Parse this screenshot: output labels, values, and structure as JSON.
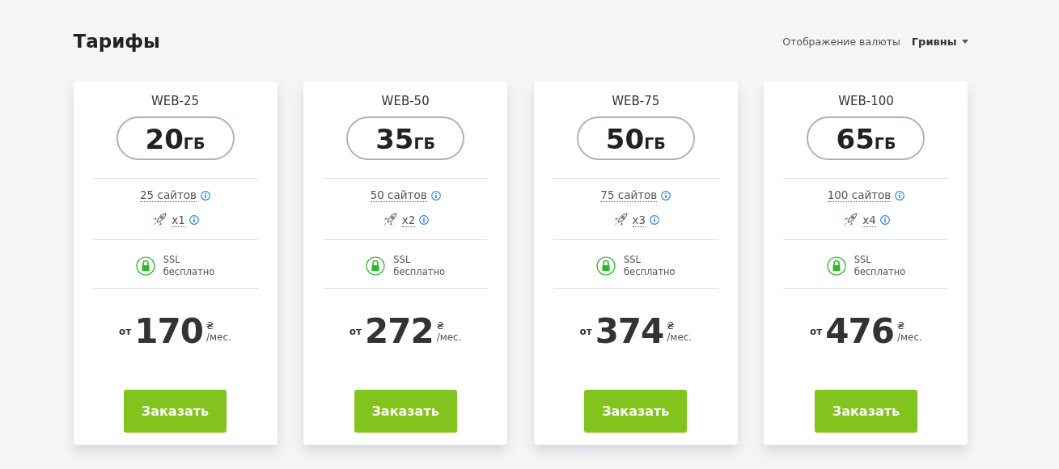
{
  "title": "Тарифы",
  "currency": {
    "label": "Отображение валюты",
    "value": "Гривны"
  },
  "plans": [
    {
      "name": "WEB-25",
      "disk": "20",
      "disk_unit": "ГБ",
      "sites": "25 сайтов",
      "speed": "x1",
      "ssl": "SSL",
      "ssl_note": "бесплатно",
      "price_prefix": "от",
      "price": "170",
      "currency_sign": "₴",
      "period": "/мес.",
      "button": "Заказать"
    },
    {
      "name": "WEB-50",
      "disk": "35",
      "disk_unit": "ГБ",
      "sites": "50 сайтов",
      "speed": "x2",
      "ssl": "SSL",
      "ssl_note": "бесплатно",
      "price_prefix": "от",
      "price": "272",
      "currency_sign": "₴",
      "period": "/мес.",
      "button": "Заказать"
    },
    {
      "name": "WEB-75",
      "disk": "50",
      "disk_unit": "ГБ",
      "sites": "75 сайтов",
      "speed": "x3",
      "ssl": "SSL",
      "ssl_note": "бесплатно",
      "price_prefix": "от",
      "price": "374",
      "currency_sign": "₴",
      "period": "/мес.",
      "button": "Заказать"
    },
    {
      "name": "WEB-100",
      "disk": "65",
      "disk_unit": "ГБ",
      "sites": "100 сайтов",
      "speed": "x4",
      "ssl": "SSL",
      "ssl_note": "бесплатно",
      "price_prefix": "от",
      "price": "476",
      "currency_sign": "₴",
      "period": "/мес.",
      "button": "Заказать"
    }
  ]
}
